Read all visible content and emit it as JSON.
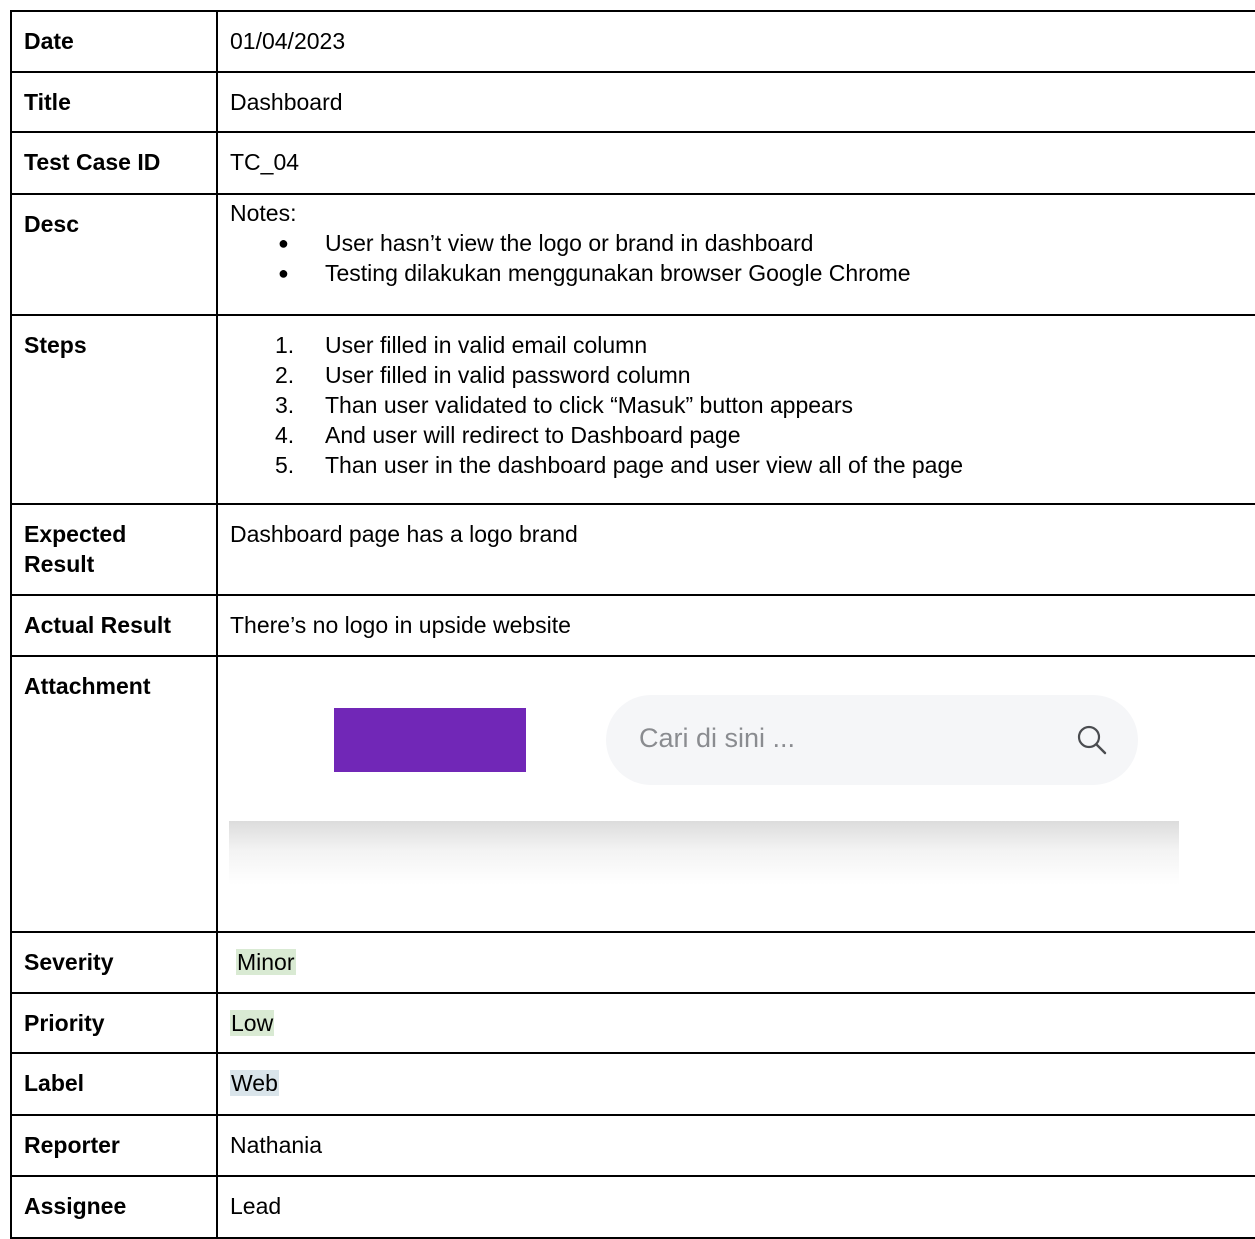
{
  "rows": {
    "date": {
      "label": "Date",
      "value": "01/04/2023"
    },
    "title": {
      "label": "Title",
      "value": "Dashboard"
    },
    "test_case_id": {
      "label": "Test Case ID",
      "value": "TC_04"
    },
    "desc": {
      "label": "Desc",
      "intro": "Notes:",
      "bullets": [
        "User hasn’t view the logo or brand in dashboard",
        "Testing dilakukan menggunakan browser Google Chrome"
      ]
    },
    "steps": {
      "label": "Steps",
      "items": [
        "User filled in valid email column",
        "User filled in valid password column",
        "Than user validated to click “Masuk” button appears",
        "And user will redirect to Dashboard page",
        "Than user in the dashboard page and user view all of the page"
      ]
    },
    "expected": {
      "label": "Expected Result",
      "value": "Dashboard page has a logo brand"
    },
    "actual": {
      "label": "Actual Result",
      "value": "There’s no logo in upside website"
    },
    "attachment": {
      "label": "Attachment",
      "search_placeholder": "Cari di sini ...",
      "logo_color": "#7127b7",
      "search_icon": "search-icon"
    },
    "severity": {
      "label": "Severity",
      "value": "Minor"
    },
    "priority": {
      "label": "Priority",
      "value": "Low"
    },
    "label": {
      "label": "Label",
      "value": "Web"
    },
    "reporter": {
      "label": "Reporter",
      "value": "Nathania"
    },
    "assignee": {
      "label": "Assignee",
      "value": "Lead"
    }
  }
}
